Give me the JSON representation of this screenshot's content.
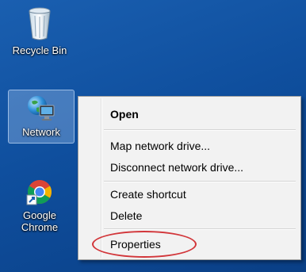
{
  "desktop": {
    "icons": [
      {
        "label": "Recycle Bin",
        "icon": "recycle-bin-icon"
      },
      {
        "label": "Network",
        "icon": "network-icon"
      },
      {
        "label_line1": "Google",
        "label_line2": "Chrome",
        "icon": "chrome-icon"
      }
    ]
  },
  "context_menu": {
    "open": "Open",
    "map_drive": "Map network drive...",
    "disconnect_drive": "Disconnect network drive...",
    "create_shortcut": "Create shortcut",
    "delete": "Delete",
    "properties": "Properties"
  },
  "colors": {
    "desktop_background": "#1257a8",
    "menu_background": "#f2f2f2",
    "highlight_circle": "#d2363a"
  }
}
